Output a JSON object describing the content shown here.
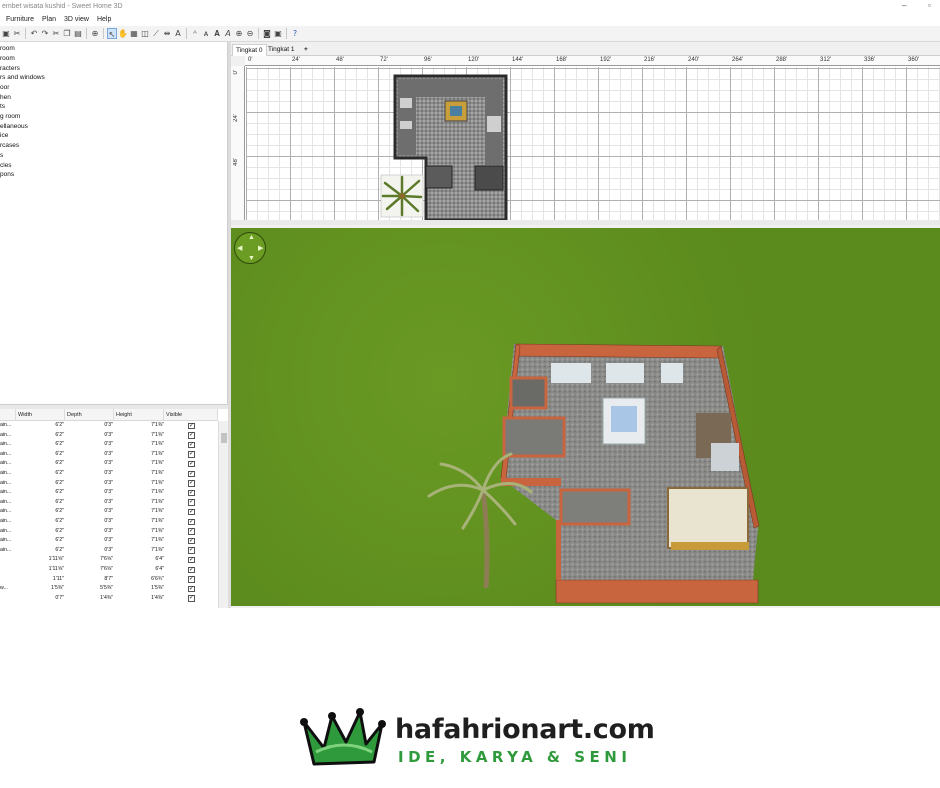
{
  "window": {
    "title": "embet wisata kushid - Sweet Home 3D",
    "controls": [
      "–",
      "▫"
    ]
  },
  "menu": [
    "Furniture",
    "Plan",
    "3D view",
    "Help"
  ],
  "toolbar": {
    "icons": [
      "save-icon",
      "cut-icon",
      "undo-icon",
      "redo-icon",
      "cut-icon",
      "copy-icon",
      "paste-icon",
      "add-furniture-icon",
      "select-icon",
      "pan-icon",
      "create-walls-icon",
      "create-rooms-icon",
      "create-polylines-icon",
      "create-dimensions-icon",
      "add-text-icon",
      "text-style-icon",
      "zoom-in-icon",
      "zoom-out-icon",
      "photo-icon",
      "video-icon",
      "help-icon"
    ]
  },
  "catalog": {
    "items": [
      "room",
      "room",
      "racters",
      "rs and windows",
      "oor",
      "hen",
      "ts",
      "g room",
      "ellaneous",
      "ice",
      "rcases",
      "s",
      "cles",
      "pons"
    ]
  },
  "furniture_table": {
    "columns": [
      "Width",
      "Depth",
      "Height",
      "Visible"
    ],
    "rows": [
      {
        "name": "ain...",
        "width": "6'2\"",
        "depth": "0'3\"",
        "height": "7'1⅜\"",
        "visible": true
      },
      {
        "name": "ain...",
        "width": "6'2\"",
        "depth": "0'3\"",
        "height": "7'1⅜\"",
        "visible": true
      },
      {
        "name": "ain...",
        "width": "6'2\"",
        "depth": "0'3\"",
        "height": "7'1⅜\"",
        "visible": true
      },
      {
        "name": "ain...",
        "width": "6'2\"",
        "depth": "0'3\"",
        "height": "7'1⅜\"",
        "visible": true
      },
      {
        "name": "ain...",
        "width": "6'2\"",
        "depth": "0'3\"",
        "height": "7'1⅜\"",
        "visible": true
      },
      {
        "name": "ain...",
        "width": "6'2\"",
        "depth": "0'3\"",
        "height": "7'1⅜\"",
        "visible": true
      },
      {
        "name": "ain...",
        "width": "6'2\"",
        "depth": "0'3\"",
        "height": "7'1⅜\"",
        "visible": true
      },
      {
        "name": "ain...",
        "width": "6'2\"",
        "depth": "0'3\"",
        "height": "7'1⅜\"",
        "visible": true
      },
      {
        "name": "ain...",
        "width": "6'2\"",
        "depth": "0'3\"",
        "height": "7'1⅜\"",
        "visible": true
      },
      {
        "name": "ain...",
        "width": "6'2\"",
        "depth": "0'3\"",
        "height": "7'1⅜\"",
        "visible": true
      },
      {
        "name": "ain...",
        "width": "6'2\"",
        "depth": "0'3\"",
        "height": "7'1⅜\"",
        "visible": true
      },
      {
        "name": "ain...",
        "width": "6'2\"",
        "depth": "0'3\"",
        "height": "7'1⅜\"",
        "visible": true
      },
      {
        "name": "ain...",
        "width": "6'2\"",
        "depth": "0'3\"",
        "height": "7'1⅜\"",
        "visible": true
      },
      {
        "name": "ain...",
        "width": "6'2\"",
        "depth": "0'3\"",
        "height": "7'1⅜\"",
        "visible": true
      },
      {
        "name": "",
        "width": "1'11⅝\"",
        "depth": "7'6⅝\"",
        "height": "6'4\"",
        "visible": true
      },
      {
        "name": "",
        "width": "1'11⅝\"",
        "depth": "7'6⅝\"",
        "height": "6'4\"",
        "visible": true
      },
      {
        "name": "",
        "width": "1'11\"",
        "depth": "8'7\"",
        "height": "6'6¾\"",
        "visible": true
      },
      {
        "name": "w...",
        "width": "1'5⅜\"",
        "depth": "5'5⅜\"",
        "height": "1'5⅜\"",
        "visible": true
      },
      {
        "name": "",
        "width": "0'7\"",
        "depth": "1'4⅜\"",
        "height": "1'4⅜\"",
        "visible": true
      }
    ]
  },
  "plan": {
    "tabs": [
      "Tingkat 0",
      "Tingkat 1"
    ],
    "add_tab": "+",
    "ruler_x": [
      "0'",
      "24'",
      "48'",
      "72'",
      "96'",
      "120'",
      "144'",
      "168'",
      "192'",
      "216'",
      "240'",
      "264'",
      "288'",
      "312'",
      "336'",
      "360'"
    ],
    "ruler_y": [
      "0'",
      "24'",
      "48'"
    ]
  },
  "view3d": {
    "ground_color": "#5b8a1d",
    "wall_color": "#c8653f",
    "floor_color": "#8a8a88"
  },
  "brand": {
    "name": "hafahrionart.com",
    "tagline": "IDE, KARYA & SENI",
    "accent": "#2f9a3c"
  }
}
